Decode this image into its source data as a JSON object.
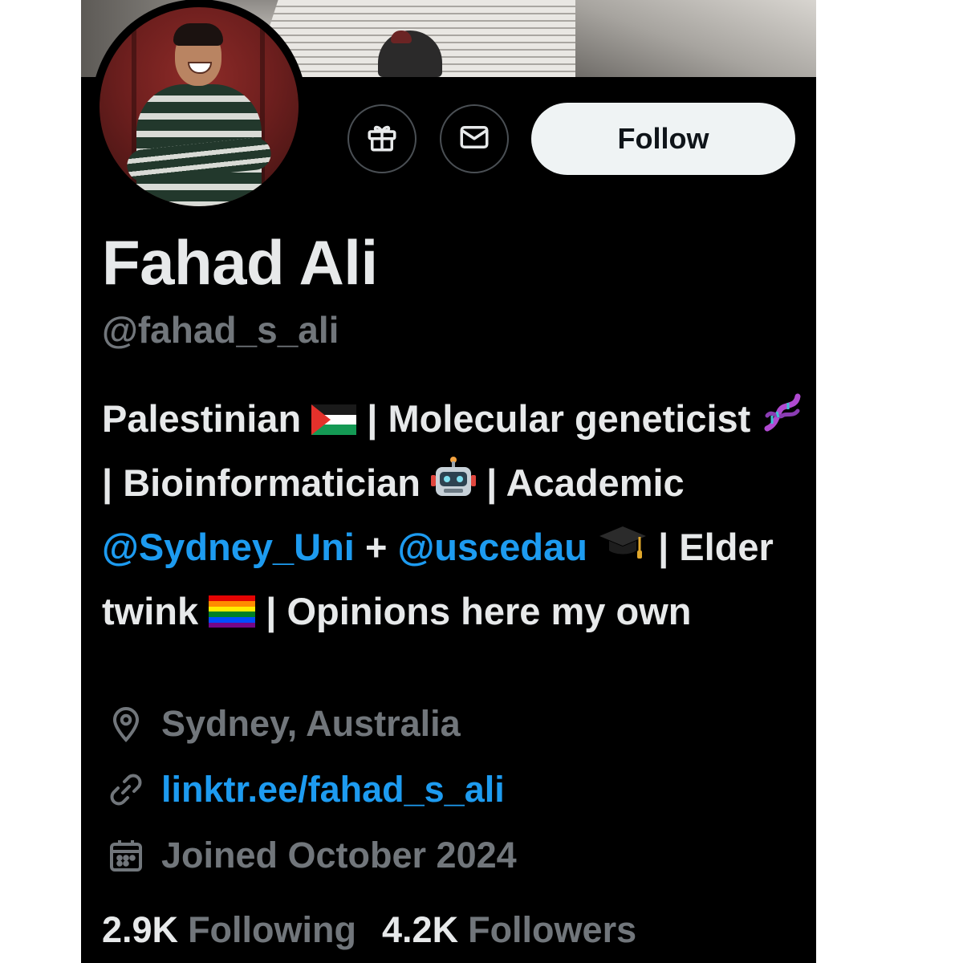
{
  "profile": {
    "name": "Fahad Ali",
    "handle": "@fahad_s_ali",
    "bio": {
      "part1": "Palestinian",
      "part2": "| Molecular geneticist",
      "part3": "| Bioinformatician",
      "part4": "| Academic",
      "mention1": "@Sydney_Uni",
      "plus": "+",
      "mention2": "@uscedau",
      "part5": "| Elder twink",
      "part6": "| Opinions here my own"
    },
    "location": "Sydney, Australia",
    "website": "linktr.ee/fahad_s_ali",
    "joined": "Joined October 2024"
  },
  "actions": {
    "gift_icon": "gift-icon",
    "message_icon": "envelope-icon",
    "follow_label": "Follow"
  },
  "stats": {
    "following_count": "2.9K",
    "following_label": "Following",
    "followers_count": "4.2K",
    "followers_label": "Followers"
  },
  "icons": {
    "location": "location-pin-icon",
    "website": "link-icon",
    "joined": "calendar-icon"
  },
  "colors": {
    "background": "#000000",
    "primary_text": "#e7e9ea",
    "secondary_text": "#71767b",
    "link": "#1d9bf0",
    "follow_button_bg": "#eff3f4"
  }
}
